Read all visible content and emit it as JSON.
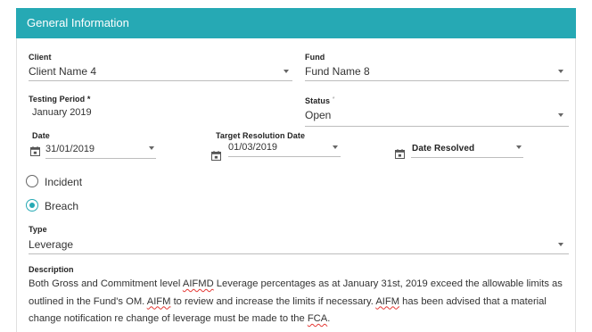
{
  "header": {
    "title": "General Information"
  },
  "client": {
    "label": "Client",
    "value": "Client Name 4"
  },
  "fund": {
    "label": "Fund",
    "value": "Fund Name 8"
  },
  "testing_period": {
    "label": "Testing Period",
    "required_mark": "*",
    "value": "January 2019"
  },
  "status": {
    "label": "Status",
    "required_mark": "*",
    "value": "Open"
  },
  "date": {
    "label": "Date",
    "value": "31/01/2019"
  },
  "target_resolution_date": {
    "label": "Target Resolution Date",
    "value": "01/03/2019"
  },
  "date_resolved": {
    "label": "Date Resolved",
    "value": ""
  },
  "incident_type": {
    "options": [
      {
        "label": "Incident",
        "selected": false
      },
      {
        "label": "Breach",
        "selected": true
      }
    ]
  },
  "type": {
    "label": "Type",
    "value": "Leverage"
  },
  "description": {
    "label": "Description",
    "parts": [
      "Both Gross and Commitment level ",
      "AIFMD",
      " Leverage percentages as at January 31st, 2019 exceed the allowable limits as outlined in the Fund's OM. ",
      "AIFM",
      " to review and increase the limits if necessary. ",
      "AIFM",
      " has been advised that a material change notification re change of leverage must be made to the ",
      "FCA",
      "."
    ]
  },
  "colors": {
    "accent": "#26a9b4",
    "header_text": "#ffffff"
  },
  "icons": {
    "calendar": "calendar-icon",
    "dropdown": "chevron-down-icon"
  }
}
